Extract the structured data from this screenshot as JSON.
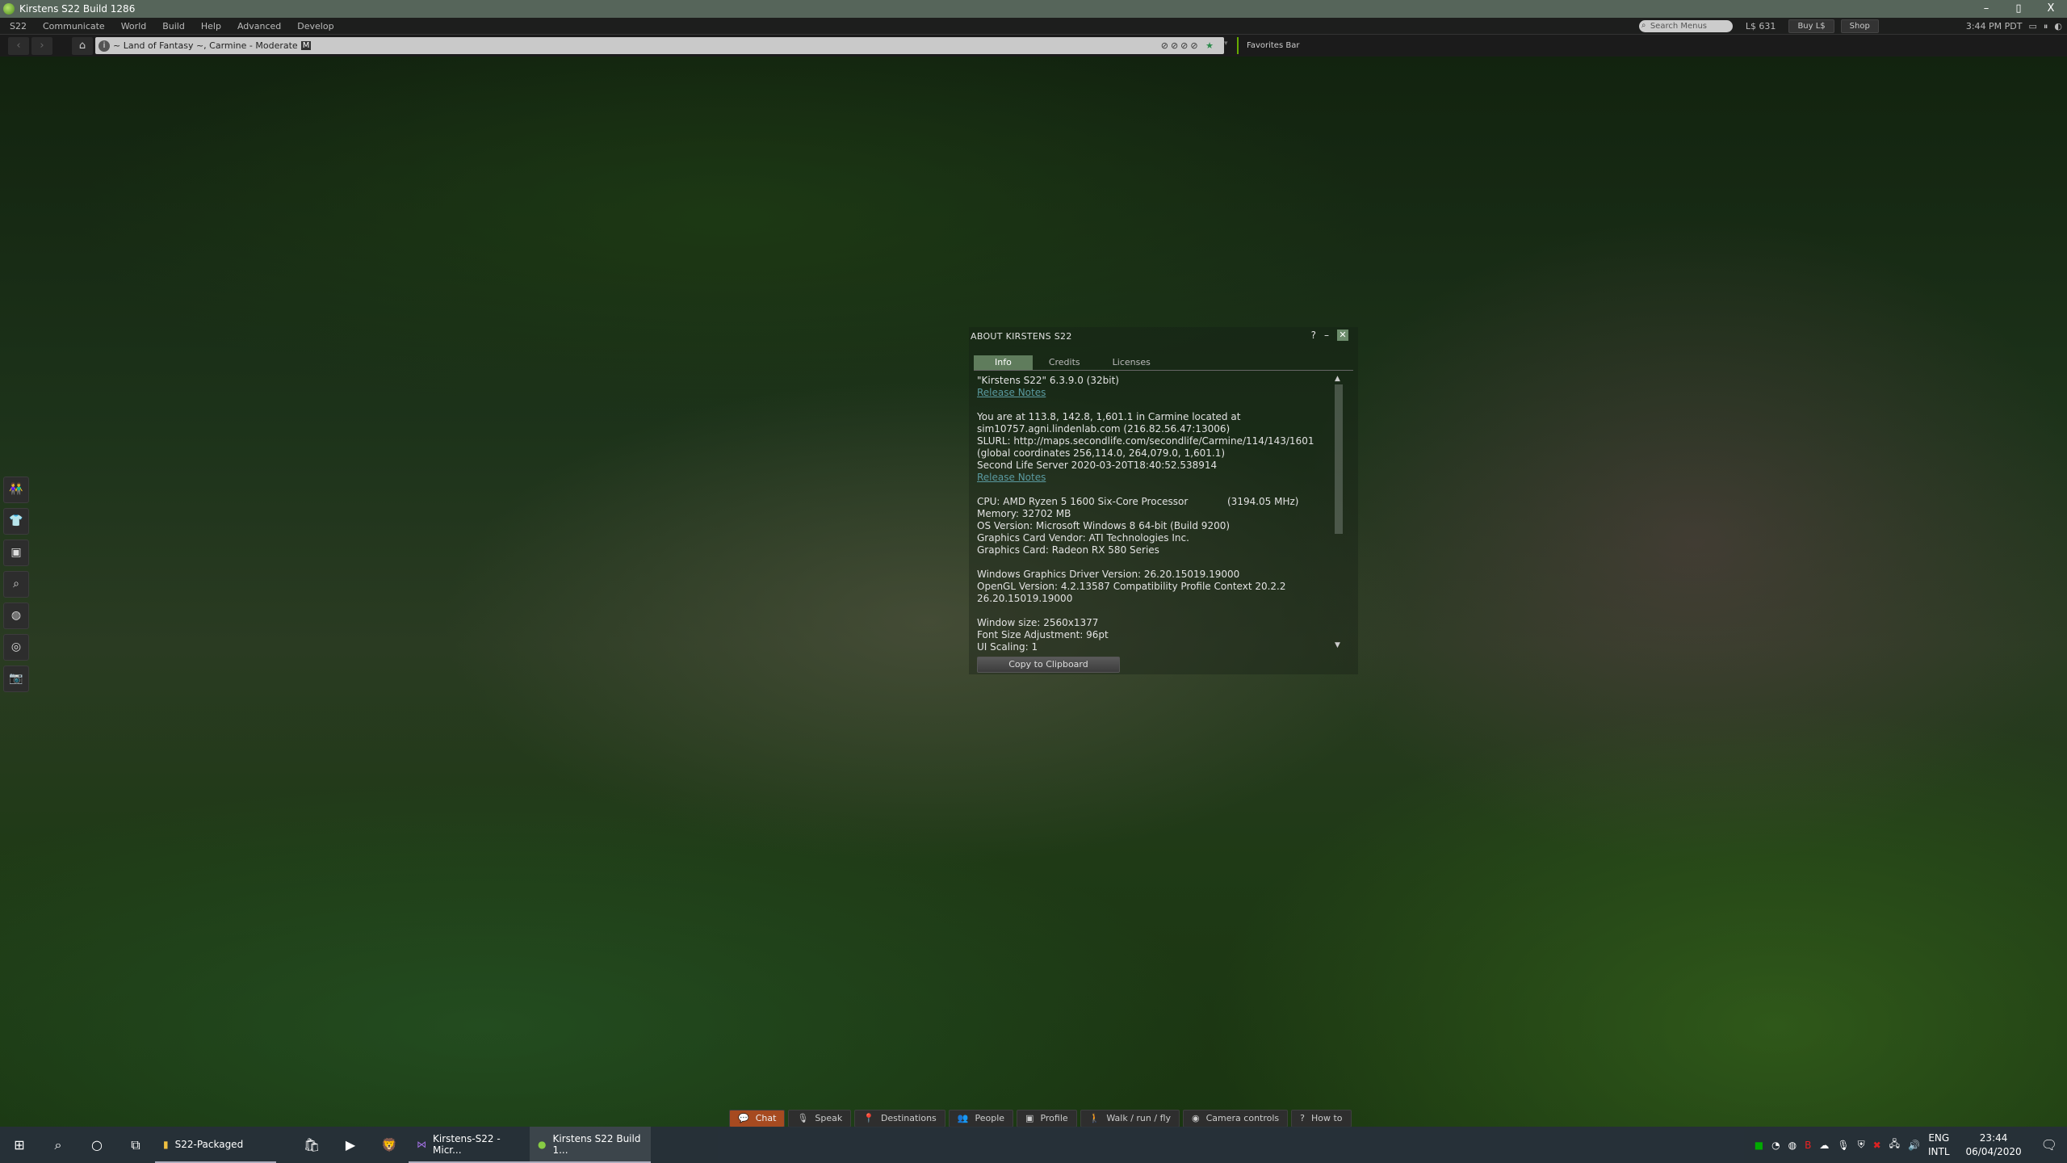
{
  "window": {
    "title": "Kirstens S22 Build 1286",
    "minimize": "–",
    "maximize": "▯",
    "close": "X"
  },
  "menu": {
    "items": [
      "S22",
      "Communicate",
      "World",
      "Build",
      "Help",
      "Advanced",
      "Develop"
    ],
    "search_placeholder": "Search Menus",
    "balance": "L$ 631",
    "buy": "Buy L$",
    "shop": "Shop",
    "time": "3:44 PM PDT"
  },
  "nav": {
    "back": "‹",
    "forward": "›",
    "home": "⌂",
    "location": "~ Land of Fantasy ~, Carmine - Moderate",
    "maturity": "M",
    "favorites": "Favorites Bar"
  },
  "left_toolbar": [
    {
      "icon": "people-icon",
      "glyph": "👫"
    },
    {
      "icon": "appearance-icon",
      "glyph": "👕"
    },
    {
      "icon": "inventory-icon",
      "glyph": "▣"
    },
    {
      "icon": "search-icon",
      "glyph": "⌕"
    },
    {
      "icon": "map-icon",
      "glyph": "◍"
    },
    {
      "icon": "nearby-icon",
      "glyph": "◎"
    },
    {
      "icon": "snapshot-icon",
      "glyph": "📷"
    }
  ],
  "about": {
    "title": "ABOUT KIRSTENS S22",
    "help": "?",
    "minimize": "–",
    "close": "✕",
    "tabs": [
      "Info",
      "Credits",
      "Licenses"
    ],
    "lines": [
      {
        "text": "\"Kirstens S22\" 6.3.9.0 (32bit)"
      },
      {
        "link": "Release Notes"
      },
      {
        "text": ""
      },
      {
        "text": "You are at 113.8, 142.8, 1,601.1 in Carmine located at"
      },
      {
        "text": "sim10757.agni.lindenlab.com (216.82.56.47:13006)"
      },
      {
        "text": "SLURL: http://maps.secondlife.com/secondlife/Carmine/114/143/1601"
      },
      {
        "text": "(global coordinates 256,114.0, 264,079.0, 1,601.1)"
      },
      {
        "text": "Second Life Server 2020-03-20T18:40:52.538914"
      },
      {
        "link": "Release Notes"
      },
      {
        "text": ""
      },
      {
        "text": "CPU: AMD Ryzen 5 1600 Six-Core Processor",
        "extra": "(3194.05 MHz)"
      },
      {
        "text": "Memory: 32702 MB"
      },
      {
        "text": "OS Version: Microsoft Windows 8 64-bit (Build 9200)"
      },
      {
        "text": "Graphics Card Vendor: ATI Technologies Inc."
      },
      {
        "text": "Graphics Card: Radeon RX 580 Series"
      },
      {
        "text": ""
      },
      {
        "text": "Windows Graphics Driver Version: 26.20.15019.19000"
      },
      {
        "text": "OpenGL Version: 4.2.13587 Compatibility Profile Context 20.2.2"
      },
      {
        "text": "26.20.15019.19000"
      },
      {
        "text": ""
      },
      {
        "text": "Window size: 2560x1377"
      },
      {
        "text": "Font Size Adjustment: 96pt"
      },
      {
        "text": "UI Scaling: 1"
      }
    ],
    "copy_button": "Copy to Clipboard"
  },
  "bottom_toolbar": [
    {
      "label": "Chat",
      "icon": "chat-icon",
      "glyph": "💬",
      "active": true
    },
    {
      "label": "Speak",
      "icon": "microphone-icon",
      "glyph": "🎙"
    },
    {
      "label": "Destinations",
      "icon": "pin-icon",
      "glyph": "📍"
    },
    {
      "label": "People",
      "icon": "people-icon",
      "glyph": "👥"
    },
    {
      "label": "Profile",
      "icon": "profile-icon",
      "glyph": "▣"
    },
    {
      "label": "Walk / run / fly",
      "icon": "walk-icon",
      "glyph": "🚶"
    },
    {
      "label": "Camera controls",
      "icon": "eye-icon",
      "glyph": "◉"
    },
    {
      "label": "How to",
      "icon": "help-book-icon",
      "glyph": "?"
    }
  ],
  "taskbar": {
    "apps": [
      {
        "label": "S22-Packaged",
        "icon": "folder-icon",
        "glyph": "📁"
      },
      {
        "label": "Kirstens-S22 - Micr...",
        "icon": "visual-studio-icon",
        "glyph": "⋈"
      },
      {
        "label": "Kirstens S22 Build 1...",
        "icon": "viewer-icon",
        "glyph": "●"
      }
    ],
    "lang": "ENG",
    "layout": "INTL",
    "time": "23:44",
    "date": "06/04/2020"
  }
}
